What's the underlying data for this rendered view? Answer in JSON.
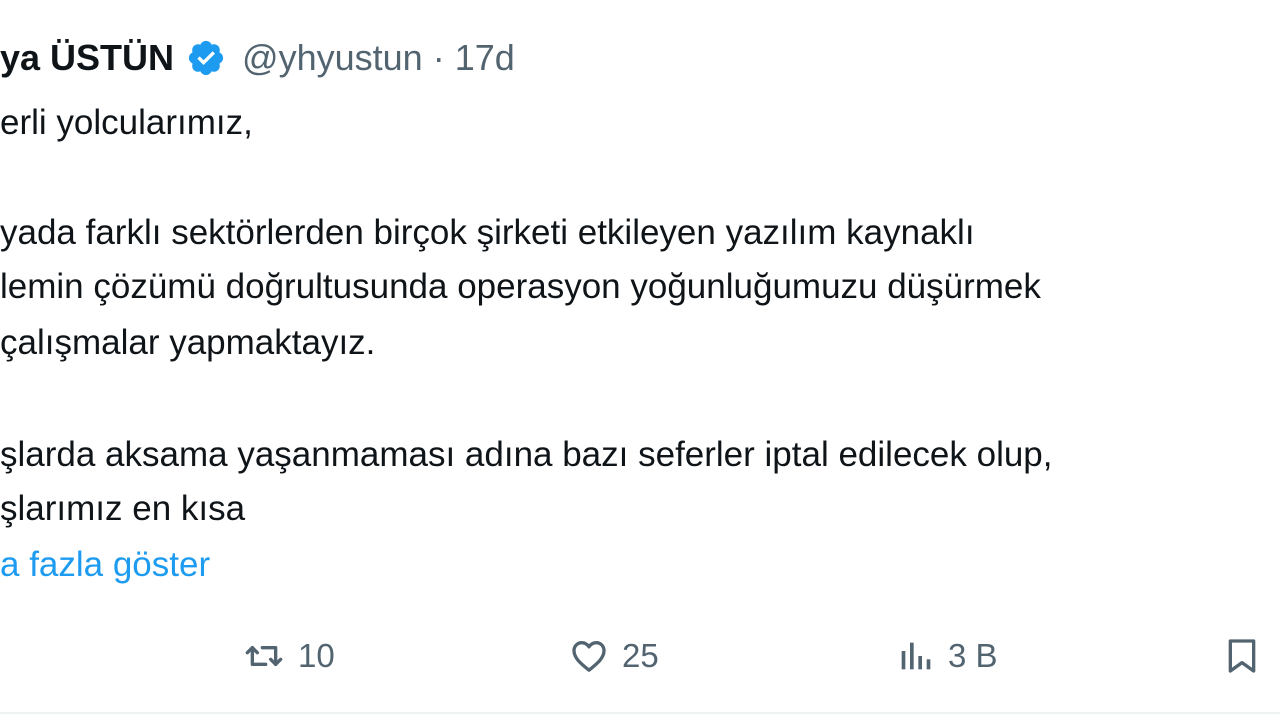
{
  "tweet": {
    "author_name": "ya ÜSTÜN",
    "handle": "@yhyustun",
    "separator": "·",
    "time": "17d",
    "verified_icon": "verified-badge-icon",
    "lines": [
      "erli yolcularımız,",
      "yada farklı sektörlerden birçok şirketi etkileyen yazılım kaynaklı",
      "lemin çözümü doğrultusunda operasyon yoğunluğumuzu düşürmek",
      "çalışmalar yapmaktayız.",
      "şlarda aksama yaşanmaması adına bazı seferler iptal edilecek olup,",
      "şlarımız en kısa"
    ],
    "show_more": "a fazla göster",
    "actions": {
      "retweet_count": "10",
      "like_count": "25",
      "views_count": "3 B"
    },
    "colors": {
      "text": "#0f1419",
      "secondary": "#536471",
      "accent": "#1d9bf0"
    }
  }
}
